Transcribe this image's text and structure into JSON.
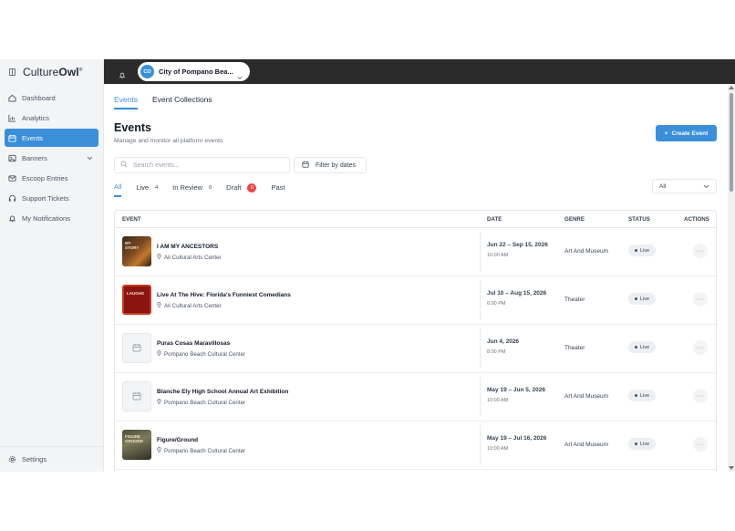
{
  "brand": {
    "name_light": "Culture",
    "name_bold": "Owl",
    "mark": "®"
  },
  "topbar": {
    "org_initials": "CO",
    "org_name": "City of Pompano Bea..."
  },
  "sidebar": {
    "items": [
      {
        "label": "Dashboard",
        "icon": "home-icon",
        "active": false
      },
      {
        "label": "Analytics",
        "icon": "chart-icon",
        "active": false
      },
      {
        "label": "Events",
        "icon": "calendar-icon",
        "active": true
      },
      {
        "label": "Banners",
        "icon": "image-icon",
        "active": false,
        "has_chevron": true
      },
      {
        "label": "Escoop Entries",
        "icon": "mail-icon",
        "active": false
      },
      {
        "label": "Support Tickets",
        "icon": "headset-icon",
        "active": false
      },
      {
        "label": "My Notifications",
        "icon": "bell-icon",
        "active": false
      }
    ],
    "settings_label": "Settings"
  },
  "tabs": [
    "Events",
    "Event Collections"
  ],
  "page": {
    "title": "Events",
    "subtitle": "Manage and monitor all platform events",
    "create_label": "Create Event",
    "create_icon": "+"
  },
  "search": {
    "placeholder": "Search events..."
  },
  "filter": {
    "label": "Filter by dates"
  },
  "status_tabs": [
    {
      "label": "All",
      "count": ""
    },
    {
      "label": "Live",
      "count": "4"
    },
    {
      "label": "In Review",
      "count": "0"
    },
    {
      "label": "Draft",
      "count": "0",
      "highlight": true
    },
    {
      "label": "Past",
      "count": ""
    }
  ],
  "status_filter": {
    "selected": "All"
  },
  "table": {
    "headers": {
      "event": "EVENT",
      "date": "DATE",
      "genre": "GENRE",
      "status": "STATUS",
      "actions": "ACTIONS"
    },
    "rows": [
      {
        "name": "I AM MY ANCESTORS",
        "venue": "Ali Cultural Arts Center",
        "date": "Jun 22 – Sep 15, 2026",
        "time": "10:00 AM",
        "genre": "Art And Museum",
        "status": "Live",
        "thumb": "ancestors",
        "thumb_text": "MY\nSTORY"
      },
      {
        "name": "Live At The Hive: Florida's Funniest Comedians",
        "venue": "Ali Cultural Arts Center",
        "date": "Jul 10 – Aug 15, 2026",
        "time": "6:00 PM",
        "genre": "Theater",
        "status": "Live",
        "thumb": "hive",
        "thumb_text": "LAUGHS"
      },
      {
        "name": "Puras Cosas Maravillosas",
        "venue": "Pompano Beach Cultural Center",
        "date": "Jun 4, 2026",
        "time": "8:00 PM",
        "genre": "Theater",
        "status": "Live",
        "thumb": "placeholder",
        "thumb_text": ""
      },
      {
        "name": "Blanche Ely High School Annual Art Exhibition",
        "venue": "Pompano Beach Cultural Center",
        "date": "May 19 – Jun 5, 2026",
        "time": "10:00 AM",
        "genre": "Art And Museum",
        "status": "Live",
        "thumb": "placeholder",
        "thumb_text": ""
      },
      {
        "name": "Figure/Ground",
        "venue": "Pompano Beach Cultural Center",
        "date": "May 19 – Jul 16, 2026",
        "time": "10:00 AM",
        "genre": "Art And Museum",
        "status": "Live",
        "thumb": "figure",
        "thumb_text": "FIGURE\nGROUND"
      }
    ]
  },
  "colors": {
    "accent": "#3b8fd9",
    "topbar": "#2b2b2b",
    "sidebar": "#f3f4f6",
    "draft_badge": "#ef4444"
  }
}
